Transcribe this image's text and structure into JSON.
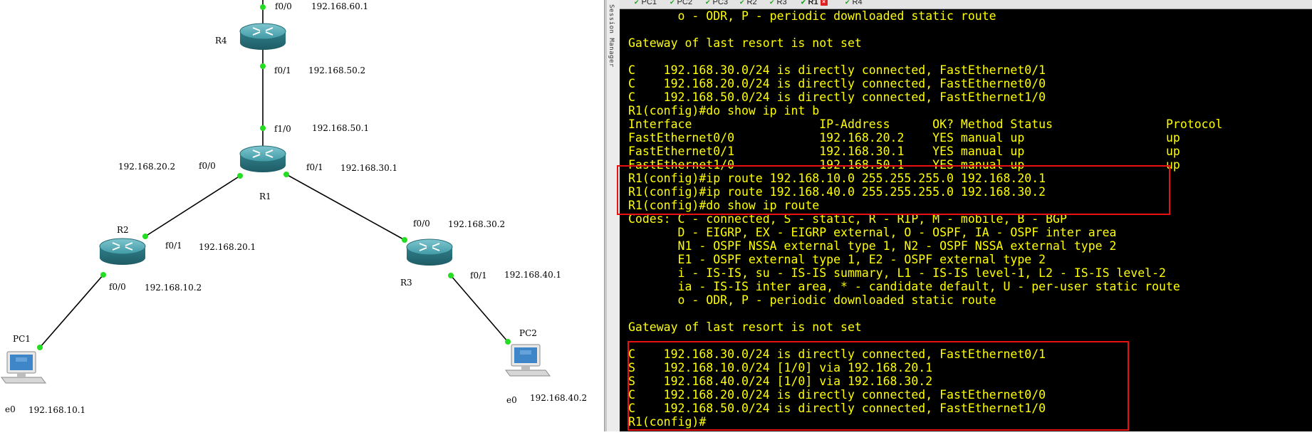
{
  "topology": {
    "devices": [
      {
        "name": "R4"
      },
      {
        "name": "R1"
      },
      {
        "name": "R2"
      },
      {
        "name": "R3"
      },
      {
        "name": "PC1"
      },
      {
        "name": "PC2"
      }
    ],
    "interface_labels": {
      "r4_f00": "f0/0",
      "r4_f00_ip": "192.168.60.1",
      "r4_f01": "f0/1",
      "r4_f01_ip": "192.168.50.2",
      "r1_f10": "f1/0",
      "r1_f10_ip": "192.168.50.1",
      "r1_f00_ip": "192.168.20.2",
      "r1_f00": "f0/0",
      "r1_f01": "f0/1",
      "r1_f01_ip": "192.168.30.1",
      "r2_f01": "f0/1",
      "r2_f01_ip": "192.168.20.1",
      "r2_f00": "f0/0",
      "r2_f00_ip": "192.168.10.2",
      "r3_f00": "f0/0",
      "r3_f00_ip": "192.168.30.2",
      "r3_f01": "f0/1",
      "r3_f01_ip": "192.168.40.1",
      "pc1_e0": "e0",
      "pc1_e0_ip": "192.168.10.1",
      "pc2_e0": "e0",
      "pc2_e0_ip": "192.168.40.2"
    }
  },
  "session_manager_label": "Session Manager",
  "tabs": [
    {
      "label": "PC1",
      "active": false
    },
    {
      "label": "PC2",
      "active": false
    },
    {
      "label": "PC3",
      "active": false
    },
    {
      "label": "R2",
      "active": false
    },
    {
      "label": "R3",
      "active": false
    },
    {
      "label": "R1",
      "active": true
    },
    {
      "label": "R4",
      "active": false
    }
  ],
  "terminal": {
    "lines": [
      "       o - ODR, P - periodic downloaded static route",
      "",
      "Gateway of last resort is not set",
      "",
      "C    192.168.30.0/24 is directly connected, FastEthernet0/1",
      "C    192.168.20.0/24 is directly connected, FastEthernet0/0",
      "C    192.168.50.0/24 is directly connected, FastEthernet1/0",
      "R1(config)#do show ip int b",
      "Interface                  IP-Address      OK? Method Status                Protocol",
      "FastEthernet0/0            192.168.20.2    YES manual up                    up",
      "FastEthernet0/1            192.168.30.1    YES manual up                    up",
      "FastEthernet1/0            192.168.50.1    YES manual up                    up",
      "R1(config)#ip route 192.168.10.0 255.255.255.0 192.168.20.1",
      "R1(config)#ip route 192.168.40.0 255.255.255.0 192.168.30.2",
      "R1(config)#do show ip route",
      "Codes: C - connected, S - static, R - RIP, M - mobile, B - BGP",
      "       D - EIGRP, EX - EIGRP external, O - OSPF, IA - OSPF inter area",
      "       N1 - OSPF NSSA external type 1, N2 - OSPF NSSA external type 2",
      "       E1 - OSPF external type 1, E2 - OSPF external type 2",
      "       i - IS-IS, su - IS-IS summary, L1 - IS-IS level-1, L2 - IS-IS level-2",
      "       ia - IS-IS inter area, * - candidate default, U - per-user static route",
      "       o - ODR, P - periodic downloaded static route",
      "",
      "Gateway of last resort is not set",
      "",
      "C    192.168.30.0/24 is directly connected, FastEthernet0/1",
      "S    192.168.10.0/24 [1/0] via 192.168.20.1",
      "S    192.168.40.0/24 [1/0] via 192.168.30.2",
      "C    192.168.20.0/24 is directly connected, FastEthernet0/0",
      "C    192.168.50.0/24 is directly connected, FastEthernet1/0",
      "R1(config)#"
    ]
  },
  "colors": {
    "terminal_bg": "#000000",
    "terminal_text": "#ffff00",
    "highlight": "#e81010",
    "link_dot": "#22dd22",
    "router": "#3a8f9c"
  }
}
